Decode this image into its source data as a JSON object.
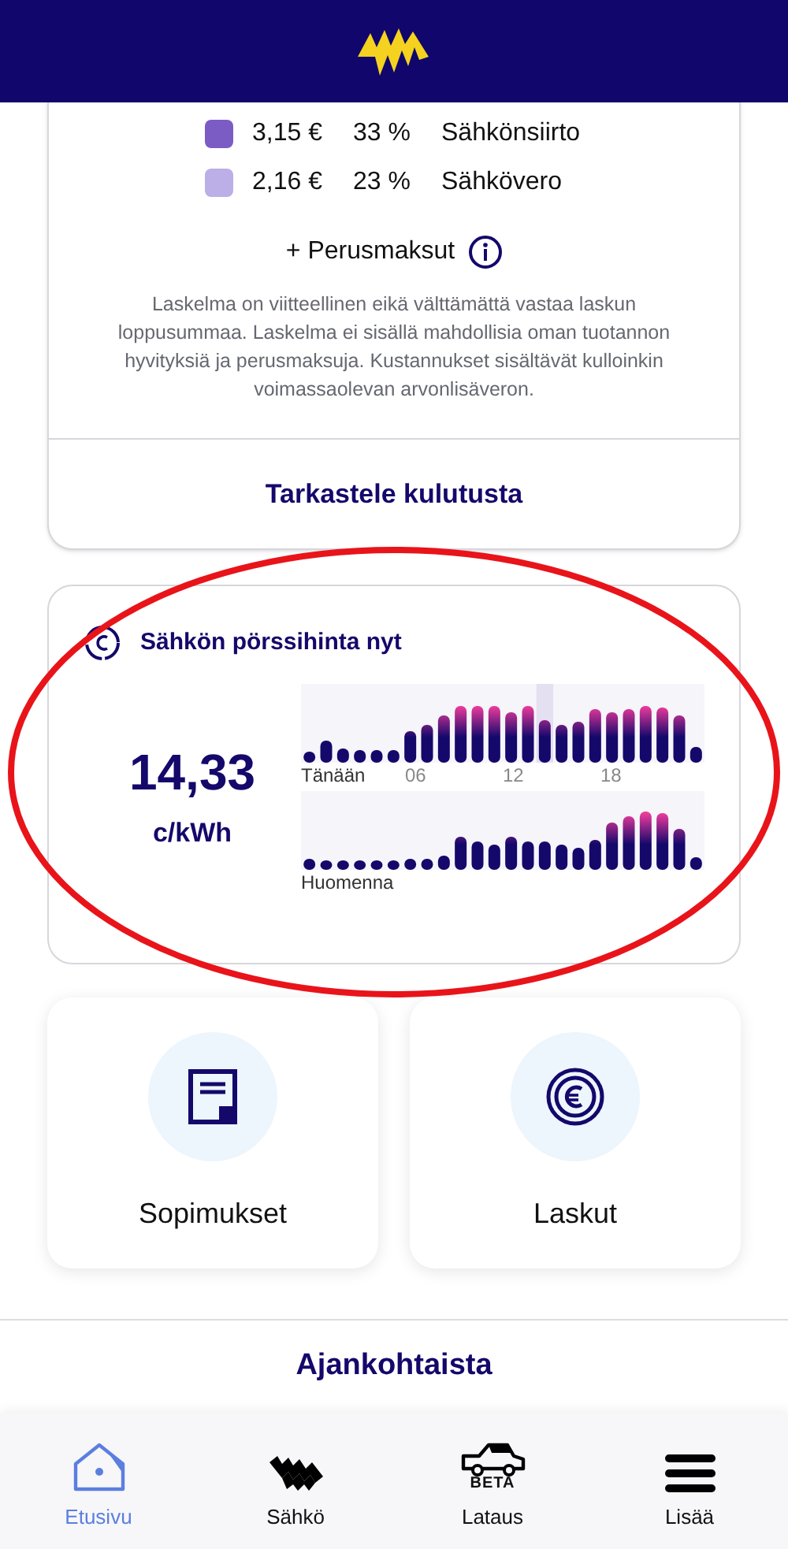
{
  "cost_breakdown": {
    "legend": [
      {
        "amount": "3,15 €",
        "percent": "33 %",
        "label": "Sähkönsiirto",
        "color": "#7b5cc4"
      },
      {
        "amount": "2,16 €",
        "percent": "23 %",
        "label": "Sähkövero",
        "color": "#bcaee6"
      }
    ],
    "base_fees": "+ Perusmaksut",
    "disclaimer": "Laskelma on viitteellinen eikä välttämättä vastaa laskun loppusummaa. Laskelma ei sisällä mahdollisia oman tuotannon hyvityksiä ja perusmaksuja. Kustannukset sisältävät kulloinkin voimassaolevan arvonlisäveron.",
    "link": "Tarkastele kulutusta"
  },
  "spot_price": {
    "title": "Sähkön pörssihinta nyt",
    "price": "14,33",
    "unit": "c/kWh",
    "today_label": "Tänään",
    "hour_ticks": [
      "06",
      "12",
      "18"
    ],
    "tomorrow_label": "Huomenna"
  },
  "tiles": [
    {
      "kind": "contract",
      "label": "Sopimukset"
    },
    {
      "kind": "invoice",
      "label": "Laskut"
    }
  ],
  "news_heading": "Ajankohtaista",
  "nav": [
    {
      "kind": "home",
      "label": "Etusivu",
      "selected": true
    },
    {
      "kind": "electricity",
      "label": "Sähkö",
      "selected": false
    },
    {
      "kind": "charging",
      "label": "Lataus",
      "badge": "BETA",
      "selected": false
    },
    {
      "kind": "more",
      "label": "Lisää",
      "selected": false
    }
  ]
}
